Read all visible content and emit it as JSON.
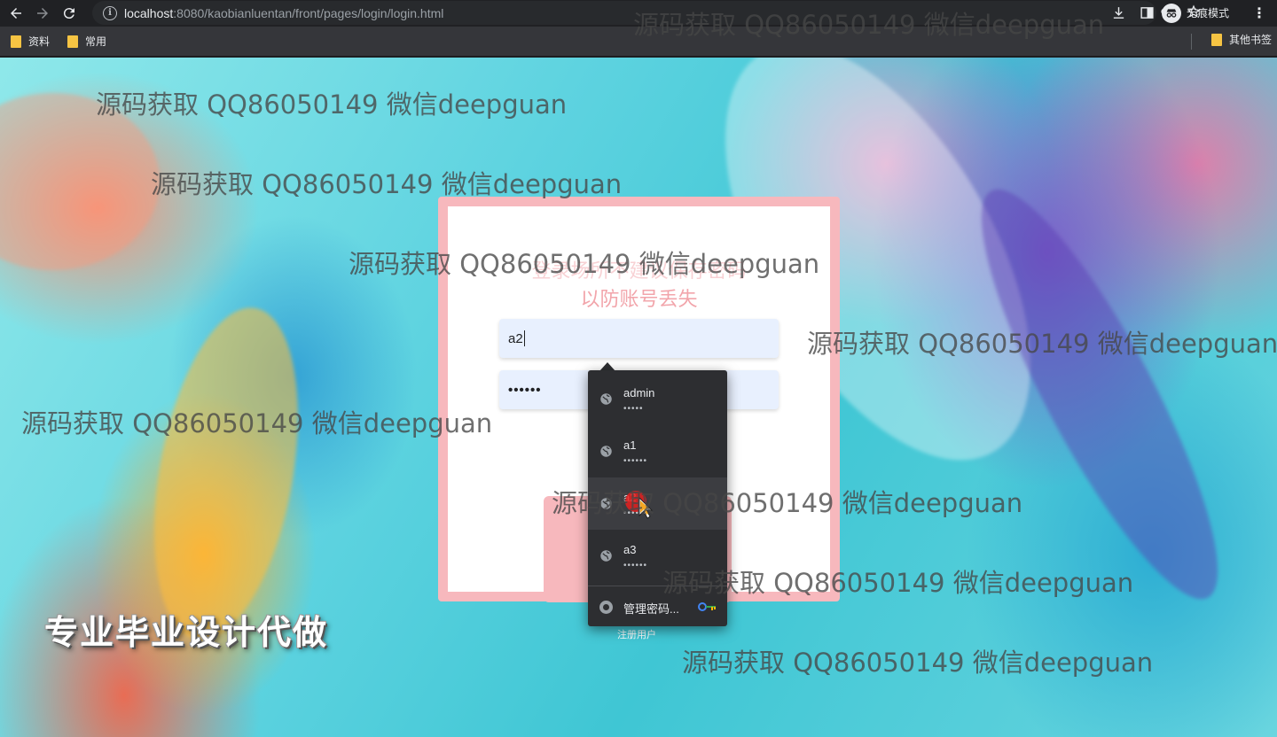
{
  "browser": {
    "url_host": "localhost",
    "url_rest": ":8080/kaobianluentan/front/pages/login/login.html",
    "incognito_label": "无痕模式",
    "bookmarks": [
      "资料",
      "常用"
    ],
    "other_bookmarks": "其他书签"
  },
  "login": {
    "title_line1": "登录场所不建议保存密码",
    "title_line2": "以防账号丢失",
    "username_value": "a2",
    "password_value": "••••••",
    "register_link": "注册用户"
  },
  "autofill": {
    "items": [
      {
        "name": "admin",
        "dots": "•••••"
      },
      {
        "name": "a1",
        "dots": "••••••"
      },
      {
        "name": "a2",
        "dots": "••••••"
      },
      {
        "name": "a3",
        "dots": "••••••"
      }
    ],
    "manage_label": "管理密码..."
  },
  "promo_text": "专业毕业设计代做",
  "watermark_text": "源码获取 QQ86050149 微信deepguan",
  "colors": {
    "card_border": "#f7b8bd",
    "title_pink": "#f2a5ab",
    "field_bg": "#e8f0fe",
    "autofill_bg": "#2d2e31"
  }
}
